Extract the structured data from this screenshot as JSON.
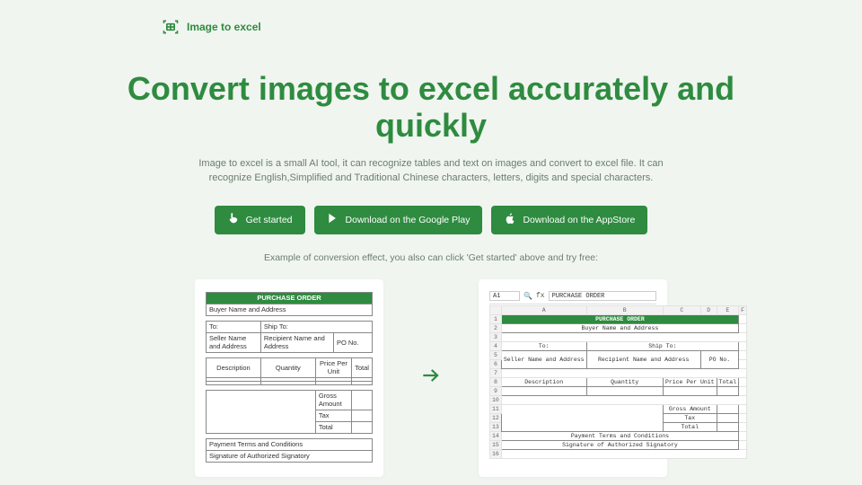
{
  "brand": {
    "name": "Image to excel"
  },
  "hero": {
    "title": "Convert images to excel accurately and quickly",
    "subtitle": "Image to excel is a small AI tool, it can recognize tables and text on images and convert to excel file. It can recognize English,Simplified and Traditional Chinese characters, letters, digits and special characters."
  },
  "cta": {
    "get_started": "Get started",
    "google_play": "Download on the Google Play",
    "app_store": "Download on the AppStore"
  },
  "example_caption": "Example of conversion effect, you also can click 'Get started' above and try free:",
  "po": {
    "title": "PURCHASE ORDER",
    "buyer": "Buyer Name and Address",
    "to": "To:",
    "ship_to": "Ship To:",
    "seller": "Seller Name and Address",
    "recipient": "Recipient Name and Address",
    "po_no": "PO No.",
    "cols": {
      "desc": "Description",
      "qty": "Quantity",
      "ppu": "Price Per Unit",
      "total": "Total"
    },
    "gross": "Gross Amount",
    "tax": "Tax",
    "total": "Total",
    "terms": "Payment Terms and Conditions",
    "sig": "Signature of Authorized Signatory"
  },
  "excel": {
    "active_cell": "A1",
    "formula_value": "PURCHASE ORDER",
    "cols": [
      "A",
      "B",
      "C",
      "D",
      "E",
      "F"
    ]
  }
}
